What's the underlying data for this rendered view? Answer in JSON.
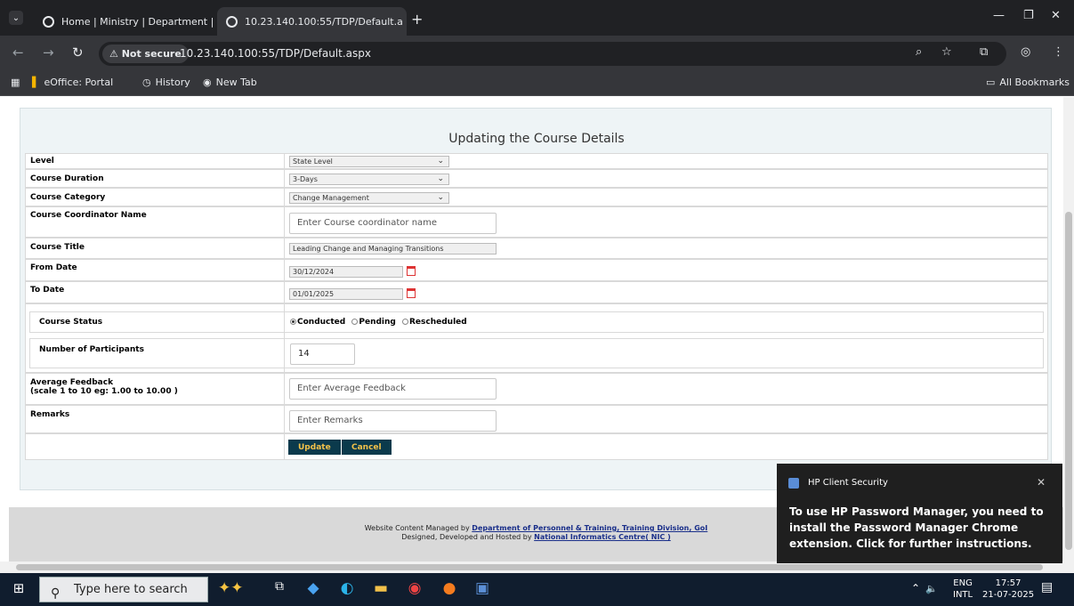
{
  "browser": {
    "tab1_title": "Home | Ministry | Department |",
    "tab2_title": "10.23.140.100:55/TDP/Default.a",
    "tab_close": "×",
    "new_tab": "+",
    "security_chip": "⚠ Not secure",
    "url": "10.23.140.100:55/TDP/Default.aspx",
    "bookmarks": [
      "eOffice: Portal",
      "History",
      "New Tab"
    ],
    "all_bookmarks": "All Bookmarks"
  },
  "form": {
    "title": "Updating the Course Details",
    "level_label": "Level",
    "level_value": "State Level",
    "duration_label": "Course Duration",
    "duration_value": "3-Days",
    "category_label": "Course Category",
    "category_value": "Change Management",
    "coordinator_label": "Course Coordinator Name",
    "coordinator_placeholder": "Enter Course coordinator name",
    "title_label": "Course Title",
    "title_value": "Leading Change and Managing Transitions",
    "from_label": "From Date",
    "from_value": "30/12/2024",
    "to_label": "To Date",
    "to_value": "01/01/2025",
    "status_label": "Course Status",
    "status_options": [
      "Conducted",
      "Pending",
      "Rescheduled"
    ],
    "status_selected": "Conducted",
    "participants_label": "Number of Participants",
    "participants_value": "14",
    "feedback_label": "Average Feedback",
    "feedback_sublabel": "(scale 1 to 10 eg: 1.00 to 10.00 )",
    "feedback_placeholder": "Enter Average Feedback",
    "remarks_label": "Remarks",
    "remarks_placeholder": "Enter Remarks",
    "update_button": "Update",
    "cancel_button": "Cancel"
  },
  "footer": {
    "line1_prefix": "Website Content Managed by",
    "line1_link": "Department of Personnel & Training, Training Division, GoI",
    "line2_prefix": "Designed, Developed and Hosted by",
    "line2_link": "National Informatics Centre( NIC )"
  },
  "toast": {
    "app": "HP Client Security",
    "message": "To use HP Password Manager, you need to install the Password Manager Chrome extension. Click for further instructions.",
    "close": "✕"
  },
  "taskbar": {
    "search_placeholder": "Type here to search",
    "lang1": "ENG",
    "lang2": "INTL",
    "time": "17:57",
    "date": "21-07-2025"
  }
}
